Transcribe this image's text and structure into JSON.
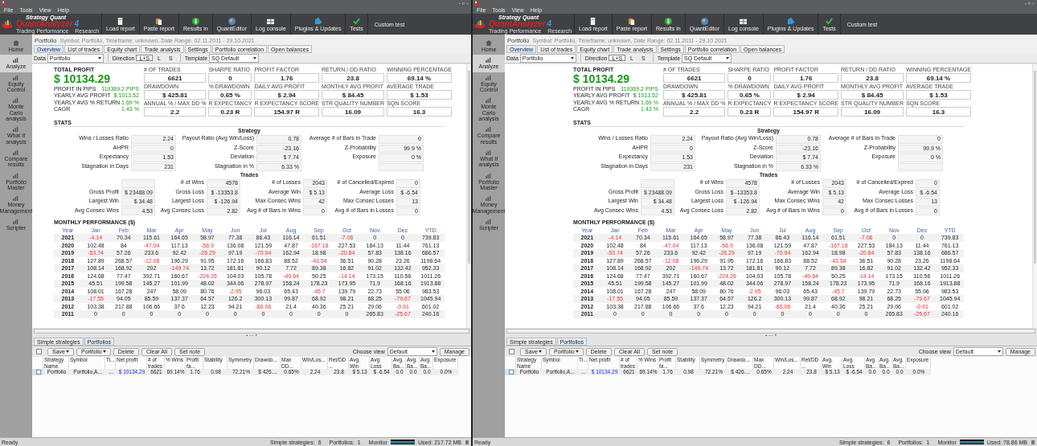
{
  "windows": [
    {
      "menu": [
        "File",
        "Tools",
        "View",
        "Help"
      ],
      "logo": {
        "brand": "Strategy Quant",
        "name": "QuantAnalyzer",
        "version": "4",
        "tagline": "Trading Performance    Research"
      },
      "toolbar": [
        {
          "label": "Load report",
          "kind": "icon"
        },
        {
          "label": "Paste report",
          "kind": "icon"
        },
        {
          "label": "Results in",
          "kind": "icon"
        },
        {
          "label": "QuantEditor",
          "kind": "icon"
        },
        {
          "label": "Log console",
          "kind": "icon"
        },
        {
          "label": "Plugins & Updates",
          "kind": "icon"
        },
        {
          "label": "Tests",
          "kind": "icon"
        },
        {
          "label": "Custom test",
          "kind": "text"
        }
      ],
      "sidebar": [
        {
          "label": "Home",
          "selected": false
        },
        {
          "label": "Analyze",
          "selected": true
        },
        {
          "label": "Equity Control",
          "selected": false
        },
        {
          "label": "Monte Carlo analysis",
          "selected": false
        },
        {
          "label": "What If analysis",
          "selected": false
        },
        {
          "label": "Compare results",
          "selected": false
        },
        {
          "label": "Portfolio Master",
          "selected": false
        },
        {
          "label": "Money Management",
          "selected": false
        },
        {
          "label": "Scripter",
          "selected": false
        }
      ],
      "header": {
        "title": "Portfolio",
        "info": "Symbol: Portfolio, Timeframe: unknown, Date Range: 02.11.2011 - 29.10.2021"
      },
      "tabs": [
        {
          "label": "Overview",
          "selected": true
        },
        {
          "label": "List of trades",
          "selected": false
        },
        {
          "label": "Equity chart",
          "selected": false
        },
        {
          "label": "Trade analysis",
          "selected": false
        },
        {
          "label": "Settings",
          "selected": false
        },
        {
          "label": "Portfolio correlation",
          "selected": false
        },
        {
          "label": "Open balances",
          "selected": false
        }
      ],
      "filters": {
        "data_label": "Data",
        "data_value": "Portfolio",
        "direction_label": "Direction",
        "directions": [
          {
            "label": "L+S",
            "selected": true
          },
          {
            "label": "L",
            "selected": false
          },
          {
            "label": "S",
            "selected": false
          }
        ],
        "template_label": "Template",
        "template_value": "SQ Default"
      },
      "summary": {
        "total_label": "TOTAL PROFIT",
        "total": "$ 10134.29",
        "rows": [
          {
            "label": "PROFIT IN PIPS",
            "value": "119369.2 PIPS"
          },
          {
            "label": "YEARLY AVG PROFIT",
            "value": "$ 1013.52"
          },
          {
            "label": "YEARLY AVG % RETURN",
            "value": "1.69 %"
          },
          {
            "label": "CAGR",
            "value": "1.43 %"
          }
        ],
        "metrics": [
          {
            "label": "# OF TRADES",
            "value": "6621"
          },
          {
            "label": "SHARPE RATIO",
            "value": "0"
          },
          {
            "label": "PROFIT FACTOR",
            "value": "1.76"
          },
          {
            "label": "RETURN / DD RATIO",
            "value": "23.8"
          },
          {
            "label": "WINNING PERCENTAGE",
            "value": "69.14 %"
          },
          {
            "label": "DRAWDOWN",
            "value": "$ 425.81"
          },
          {
            "label": "% DRAWDOWN",
            "value": "0.65 %"
          },
          {
            "label": "DAILY AVG PROFIT",
            "value": "$ 2.94"
          },
          {
            "label": "MONTHLY AVG PROFIT",
            "value": "$ 84.45"
          },
          {
            "label": "AVERAGE TRADE",
            "value": "$ 1.53"
          },
          {
            "label": "ANNUAL % / MAX DD %",
            "value": "2.2"
          },
          {
            "label": "R EXPECTANCY",
            "value": "0.23 R"
          },
          {
            "label": "R EXPECTANCY SCORE",
            "value": "154.97 R"
          },
          {
            "label": "STR QUALITY NUMBER",
            "value": "16.09"
          },
          {
            "label": "SQN SCORE",
            "value": "16.3"
          }
        ]
      },
      "stats": {
        "title": "STATS",
        "strategy_title": "Strategy",
        "strategy": [
          {
            "label": "Wins / Losses Ratio",
            "value": "2.24",
            "kind": "pair"
          },
          {
            "label": "Payout Ratio (Avg Win/Loss)",
            "value": "0.78",
            "kind": "pair"
          },
          {
            "label": "Average # of Bars in Trade",
            "value": "0",
            "kind": "pair"
          },
          {
            "label": "AHPR",
            "value": "0",
            "kind": "pair"
          },
          {
            "label": "Z-Score",
            "value": "-23.16",
            "kind": "pair"
          },
          {
            "label": "Z-Probability",
            "value": "99.9 %",
            "kind": "pair"
          },
          {
            "label": "Expectancy",
            "value": "1.53",
            "kind": "pair"
          },
          {
            "label": "Deviation",
            "value": "$ 7.74",
            "kind": "pair"
          },
          {
            "label": "Exposure",
            "value": "0 %",
            "kind": "pair"
          },
          {
            "label": "Stagnation in Days",
            "value": "231",
            "kind": "pair"
          },
          {
            "label": "Stagnation in %",
            "value": "6.33 %",
            "kind": "pair"
          },
          {
            "kind": "blank"
          }
        ],
        "trades_title": "Trades",
        "trades": [
          {
            "kind": "blank"
          },
          {
            "label": "# of Wins",
            "value": "4578",
            "kind": "pair"
          },
          {
            "label": "# of Losses",
            "value": "2043",
            "kind": "pair"
          },
          {
            "label": "# of Cancelled/Expired",
            "value": "0",
            "kind": "pair"
          },
          {
            "label": "Gross Profit",
            "value": "$ 23488.09",
            "kind": "pair"
          },
          {
            "label": "Gross Loss",
            "value": "$ -13353.8",
            "kind": "pair"
          },
          {
            "label": "Average Win",
            "value": "$ 5.13",
            "kind": "pair"
          },
          {
            "label": "Average Loss",
            "value": "$ -6.54",
            "kind": "pair"
          },
          {
            "label": "Largest Win",
            "value": "$ 34.48",
            "kind": "pair"
          },
          {
            "label": "Largest Loss",
            "value": "$ -126.94",
            "kind": "pair"
          },
          {
            "label": "Max Consec Wins",
            "value": "42",
            "kind": "pair"
          },
          {
            "label": "Max Consec Losses",
            "value": "13",
            "kind": "pair"
          },
          {
            "label": "Avg Consec Wins",
            "value": "4.53",
            "kind": "pair"
          },
          {
            "label": "Avg Consec Loss",
            "value": "2.82",
            "kind": "pair"
          },
          {
            "label": "Avg # of Bars in Wins",
            "value": "0",
            "kind": "pair"
          },
          {
            "label": "Avg # of Bars in Losses",
            "value": "0",
            "kind": "pair"
          }
        ]
      },
      "monthly": {
        "title": "MONTHLY PERFORMANCE ($)",
        "columns": [
          "Year",
          "Jan",
          "Feb",
          "Mar",
          "Apr",
          "May",
          "Jun",
          "Jul",
          "Aug",
          "Sep",
          "Oct",
          "Nov",
          "Dec",
          "YTD"
        ],
        "rows": [
          {
            "year": "2021",
            "values": [
              "-4.14",
              "70.34",
              "115.61",
              "164.65",
              "58.97",
              "77.38",
              "86.43",
              "116.14",
              "61.51",
              "-7.06",
              "0",
              "0",
              "739.83"
            ],
            "negative": [
              true,
              false,
              false,
              false,
              false,
              false,
              false,
              false,
              false,
              true,
              false,
              false,
              false
            ]
          },
          {
            "year": "2020",
            "values": [
              "102.48",
              "84",
              "-47.04",
              "117.13",
              "-56.9",
              "136.08",
              "121.59",
              "47.87",
              "-167.18",
              "227.53",
              "184.13",
              "11.44",
              "761.13"
            ],
            "negative": [
              false,
              false,
              true,
              false,
              true,
              false,
              false,
              false,
              true,
              false,
              false,
              false,
              false
            ]
          },
          {
            "year": "2019",
            "values": [
              "-53.74",
              "57.26",
              "233.6",
              "92.42",
              "-26.29",
              "97.19",
              "-70.94",
              "162.94",
              "18.98",
              "-20.84",
              "57.83",
              "138.16",
              "686.57"
            ],
            "negative": [
              true,
              false,
              false,
              false,
              true,
              false,
              true,
              false,
              false,
              true,
              false,
              false,
              false
            ]
          },
          {
            "year": "2018",
            "values": [
              "127.89",
              "268.57",
              "-12.08",
              "196.29",
              "91.95",
              "172.16",
              "166.83",
              "88.52",
              "-43.54",
              "36.51",
              "90.28",
              "23.26",
              "1198.64"
            ],
            "negative": [
              false,
              false,
              true,
              false,
              false,
              false,
              false,
              false,
              true,
              false,
              false,
              false,
              false
            ]
          },
          {
            "year": "2017",
            "values": [
              "108.14",
              "168.92",
              "202",
              "-149.74",
              "13.72",
              "181.81",
              "90.12",
              "7.72",
              "89.38",
              "16.82",
              "91.02",
              "132.42",
              "952.33"
            ],
            "negative": [
              false,
              false,
              false,
              true,
              false,
              false,
              false,
              false,
              false,
              false,
              false,
              false,
              false
            ]
          },
          {
            "year": "2016",
            "values": [
              "124.68",
              "77.47",
              "392.71",
              "160.67",
              "-224.26",
              "104.03",
              "105.78",
              "-49.64",
              "50.25",
              "-14.14",
              "173.15",
              "110.56",
              "1011.26"
            ],
            "negative": [
              false,
              false,
              false,
              false,
              true,
              false,
              false,
              true,
              false,
              true,
              false,
              false,
              false
            ]
          },
          {
            "year": "2015",
            "values": [
              "45.51",
              "199.58",
              "145.27",
              "101.99",
              "48.02",
              "344.06",
              "278.97",
              "158.24",
              "178.23",
              "173.95",
              "71.9",
              "168.16",
              "1913.88"
            ],
            "negative": [
              false,
              false,
              false,
              false,
              false,
              false,
              false,
              false,
              false,
              false,
              false,
              false,
              false
            ]
          },
          {
            "year": "2014",
            "values": [
              "108.01",
              "167.28",
              "247",
              "58.09",
              "80.76",
              "-2.95",
              "96.03",
              "65.43",
              "-45.7",
              "139.79",
              "22.73",
              "55.06",
              "983.53"
            ],
            "negative": [
              false,
              false,
              false,
              false,
              false,
              true,
              false,
              false,
              true,
              false,
              false,
              false,
              false
            ]
          },
          {
            "year": "2013",
            "values": [
              "-17.55",
              "94.05",
              "85.59",
              "137.37",
              "64.57",
              "126.2",
              "300.13",
              "99.87",
              "68.92",
              "98.21",
              "68.25",
              "-79.67",
              "1045.94"
            ],
            "negative": [
              true,
              false,
              false,
              false,
              false,
              false,
              false,
              false,
              false,
              false,
              false,
              true,
              false
            ]
          },
          {
            "year": "2012",
            "values": [
              "103.38",
              "217.88",
              "106.66",
              "37.6",
              "12.23",
              "94.21",
              "-86.06",
              "21.4",
              "40.36",
              "25.21",
              "29.06",
              "-0.91",
              "601.02"
            ],
            "negative": [
              false,
              false,
              false,
              false,
              false,
              false,
              true,
              false,
              false,
              false,
              false,
              true,
              false
            ]
          },
          {
            "year": "2011",
            "values": [
              "0",
              "0",
              "0",
              "0",
              "0",
              "0",
              "0",
              "0",
              "0",
              "0",
              "265.83",
              "-25.67",
              "240.16"
            ],
            "negative": [
              false,
              false,
              false,
              false,
              false,
              false,
              false,
              false,
              false,
              false,
              false,
              true,
              false
            ]
          }
        ]
      },
      "bottom_tabs": [
        {
          "label": "Simple strategies",
          "selected": false
        },
        {
          "label": "Portfolios",
          "selected": true
        }
      ],
      "actions": [
        {
          "label": "Save",
          "dropdown": true
        },
        {
          "label": "Portfolio",
          "dropdown": true
        },
        {
          "label": "Delete",
          "dropdown": false
        },
        {
          "label": "Clear All",
          "dropdown": false
        },
        {
          "label": "Set note",
          "dropdown": false
        }
      ],
      "view": {
        "label": "Choose view",
        "value": "Default",
        "button": "Manage"
      },
      "table": {
        "select_all_checked": false,
        "columns": [
          "Strategy Name",
          "Symbol",
          "Ti...",
          "Net profit",
          "# of trades",
          "% Wins",
          "Profit fa...",
          "Stability",
          "Symmetry",
          "Drawdo...",
          "Max DD...",
          "Win/Los...",
          "Ret/DD ...",
          "Avg. Win",
          "Avg. Loss",
          "Avg. Ba...",
          "Avg. Ba...",
          "Avg. Ba...",
          "Exposure"
        ],
        "rows": [
          {
            "checked": false,
            "cells": [
              "Portfolio",
              "Portfolio,A...",
              "...",
              "$ 10134.29",
              "6621",
              "69.14%",
              "1.76",
              "0.98",
              "72.21%",
              "$ 426....",
              "0.65%",
              "2.24",
              "23.8",
              "$ 5.13",
              "$ -6.54",
              "0.0",
              "0.0",
              "0.0",
              "0.0%"
            ]
          }
        ]
      },
      "status": {
        "left": "Ready",
        "strategies_label": "Simple strategies:",
        "strategies": "6",
        "portfolios_label": "Portfolios:",
        "portfolios": "1",
        "monitor_label": "Monitor",
        "used": "Used: 217.72 MB"
      }
    },
    {
      "menu": [
        "File",
        "Tools",
        "View",
        "Help"
      ],
      "logo": {
        "brand": "Strategy Quant",
        "name": "QuantAnalyzer",
        "version": "4",
        "tagline": "Trading Performance    Research"
      },
      "toolbar": [
        {
          "label": "Load report",
          "kind": "icon"
        },
        {
          "label": "Paste report",
          "kind": "icon"
        },
        {
          "label": "Results in",
          "kind": "icon"
        },
        {
          "label": "QuantEditor",
          "kind": "icon"
        },
        {
          "label": "Log console",
          "kind": "icon"
        },
        {
          "label": "Plugins & Updates",
          "kind": "icon"
        },
        {
          "label": "Tests",
          "kind": "icon"
        },
        {
          "label": "Custom test",
          "kind": "text"
        }
      ],
      "sidebar": [
        {
          "label": "Home",
          "selected": false
        },
        {
          "label": "Analyze",
          "selected": true
        },
        {
          "label": "Equity Control",
          "selected": false
        },
        {
          "label": "Monte Carlo analysis",
          "selected": false
        },
        {
          "label": "Compare results",
          "selected": false
        },
        {
          "label": "What If analysis",
          "selected": false
        },
        {
          "label": "Portfolio Master",
          "selected": false
        },
        {
          "label": "Money Management",
          "selected": false
        },
        {
          "label": "Scripter",
          "selected": false
        }
      ],
      "header": {
        "title": "Portfolio",
        "info": "Symbol: Portfolio, Timeframe: unknown, Date Range: 02.11.2011 - 29.10.2021"
      },
      "tabs": [
        {
          "label": "Overview",
          "selected": true
        },
        {
          "label": "List of trades",
          "selected": false
        },
        {
          "label": "Equity chart",
          "selected": false
        },
        {
          "label": "Trade analysis",
          "selected": false
        },
        {
          "label": "Settings",
          "selected": false
        },
        {
          "label": "Portfolio correlation",
          "selected": false
        },
        {
          "label": "Open balances",
          "selected": false
        }
      ],
      "filters": {
        "data_label": "Data",
        "data_value": "Portfolio",
        "direction_label": "Direction",
        "directions": [
          {
            "label": "L+S",
            "selected": true
          },
          {
            "label": "L",
            "selected": false
          },
          {
            "label": "S",
            "selected": false
          }
        ],
        "template_label": "Template",
        "template_value": "SQ Default"
      },
      "summary": {
        "total_label": "TOTAL PROFIT",
        "total": "$ 10134.29",
        "rows": [
          {
            "label": "PROFIT IN PIPS",
            "value": "119369.2 PIPS"
          },
          {
            "label": "YEARLY AVG PROFIT",
            "value": "$ 1013.52"
          },
          {
            "label": "YEARLY AVG % RETURN",
            "value": "1.69 %"
          },
          {
            "label": "CAGR",
            "value": "1.43 %"
          }
        ],
        "metrics": [
          {
            "label": "# OF TRADES",
            "value": "6621"
          },
          {
            "label": "SHARPE RATIO",
            "value": "0"
          },
          {
            "label": "PROFIT FACTOR",
            "value": "1.76"
          },
          {
            "label": "RETURN / DD RATIO",
            "value": "23.8"
          },
          {
            "label": "WINNING PERCENTAGE",
            "value": "69.14 %"
          },
          {
            "label": "DRAWDOWN",
            "value": "$ 425.81"
          },
          {
            "label": "% DRAWDOWN",
            "value": "0.65 %"
          },
          {
            "label": "DAILY AVG PROFIT",
            "value": "$ 2.94"
          },
          {
            "label": "MONTHLY AVG PROFIT",
            "value": "$ 84.45"
          },
          {
            "label": "AVERAGE TRADE",
            "value": "$ 1.53"
          },
          {
            "label": "ANNUAL % / MAX DD %",
            "value": "2.2"
          },
          {
            "label": "R EXPECTANCY",
            "value": "0.23 R"
          },
          {
            "label": "R EXPECTANCY SCORE",
            "value": "154.97 R"
          },
          {
            "label": "STR QUALITY NUMBER",
            "value": "16.09"
          },
          {
            "label": "SQN SCORE",
            "value": "16.3"
          }
        ]
      },
      "stats": {
        "title": "STATS",
        "strategy_title": "Strategy",
        "strategy": [
          {
            "label": "Wins / Losses Ratio",
            "value": "2.24",
            "kind": "pair"
          },
          {
            "label": "Payout Ratio (Avg Win/Loss)",
            "value": "0.78",
            "kind": "pair"
          },
          {
            "label": "Average # of Bars in Trade",
            "value": "0",
            "kind": "pair"
          },
          {
            "label": "AHPR",
            "value": "0",
            "kind": "pair"
          },
          {
            "label": "Z-Score",
            "value": "-23.16",
            "kind": "pair"
          },
          {
            "label": "Z-Probability",
            "value": "99.9 %",
            "kind": "pair"
          },
          {
            "label": "Expectancy",
            "value": "1.53",
            "kind": "pair"
          },
          {
            "label": "Deviation",
            "value": "$ 7.74",
            "kind": "pair"
          },
          {
            "label": "Exposure",
            "value": "0 %",
            "kind": "pair"
          },
          {
            "label": "Stagnation in Days",
            "value": "231",
            "kind": "pair"
          },
          {
            "label": "Stagnation in %",
            "value": "6.33 %",
            "kind": "pair"
          },
          {
            "kind": "blank"
          }
        ],
        "trades_title": "Trades",
        "trades": [
          {
            "kind": "blank"
          },
          {
            "label": "# of Wins",
            "value": "4578",
            "kind": "pair"
          },
          {
            "label": "# of Losses",
            "value": "2043",
            "kind": "pair"
          },
          {
            "label": "# of Cancelled/Expired",
            "value": "0",
            "kind": "pair"
          },
          {
            "label": "Gross Profit",
            "value": "$ 23488.09",
            "kind": "pair"
          },
          {
            "label": "Gross Loss",
            "value": "$ -13353.8",
            "kind": "pair"
          },
          {
            "label": "Average Win",
            "value": "$ 5.13",
            "kind": "pair"
          },
          {
            "label": "Average Loss",
            "value": "$ -6.54",
            "kind": "pair"
          },
          {
            "label": "Largest Win",
            "value": "$ 34.48",
            "kind": "pair"
          },
          {
            "label": "Largest Loss",
            "value": "$ -126.94",
            "kind": "pair"
          },
          {
            "label": "Max Consec Wins",
            "value": "42",
            "kind": "pair"
          },
          {
            "label": "Max Consec Losses",
            "value": "13",
            "kind": "pair"
          },
          {
            "label": "Avg Consec Wins",
            "value": "4.53",
            "kind": "pair"
          },
          {
            "label": "Avg Consec Loss",
            "value": "2.82",
            "kind": "pair"
          },
          {
            "label": "Avg # of Bars in Wins",
            "value": "0",
            "kind": "pair"
          },
          {
            "label": "Avg # of Bars in Losses",
            "value": "0",
            "kind": "pair"
          }
        ]
      },
      "monthly": {
        "title": "MONTHLY PERFORMANCE ($)",
        "columns": [
          "Year",
          "Jan",
          "Feb",
          "Mar",
          "Apr",
          "May",
          "Jun",
          "Jul",
          "Aug",
          "Sep",
          "Oct",
          "Nov",
          "Dec",
          "YTD"
        ],
        "rows": [
          {
            "year": "2021",
            "values": [
              "-4.14",
              "70.34",
              "115.61",
              "164.65",
              "58.97",
              "77.38",
              "86.43",
              "116.14",
              "61.51",
              "-7.06",
              "0",
              "0",
              "739.83"
            ],
            "negative": [
              true,
              false,
              false,
              false,
              false,
              false,
              false,
              false,
              false,
              true,
              false,
              false,
              false
            ]
          },
          {
            "year": "2020",
            "values": [
              "102.48",
              "84",
              "-47.04",
              "117.13",
              "-56.9",
              "136.08",
              "121.59",
              "47.87",
              "-167.18",
              "227.53",
              "184.13",
              "11.44",
              "761.13"
            ],
            "negative": [
              false,
              false,
              true,
              false,
              true,
              false,
              false,
              false,
              true,
              false,
              false,
              false,
              false
            ]
          },
          {
            "year": "2019",
            "values": [
              "-53.74",
              "57.26",
              "233.6",
              "92.42",
              "-26.29",
              "97.19",
              "-70.94",
              "162.94",
              "18.98",
              "-20.84",
              "57.83",
              "138.16",
              "686.57"
            ],
            "negative": [
              true,
              false,
              false,
              false,
              true,
              false,
              true,
              false,
              false,
              true,
              false,
              false,
              false
            ]
          },
          {
            "year": "2018",
            "values": [
              "127.89",
              "268.57",
              "-12.08",
              "196.29",
              "91.95",
              "172.16",
              "166.83",
              "88.52",
              "-43.54",
              "36.51",
              "90.28",
              "23.26",
              "1198.64"
            ],
            "negative": [
              false,
              false,
              true,
              false,
              false,
              false,
              false,
              false,
              true,
              false,
              false,
              false,
              false
            ]
          },
          {
            "year": "2017",
            "values": [
              "108.14",
              "168.92",
              "202",
              "-149.74",
              "13.72",
              "181.81",
              "90.12",
              "7.72",
              "89.38",
              "16.82",
              "91.02",
              "132.42",
              "952.33"
            ],
            "negative": [
              false,
              false,
              false,
              true,
              false,
              false,
              false,
              false,
              false,
              false,
              false,
              false,
              false
            ]
          },
          {
            "year": "2016",
            "values": [
              "124.68",
              "77.47",
              "392.71",
              "160.67",
              "-224.26",
              "104.03",
              "105.78",
              "-49.64",
              "50.25",
              "-14.14",
              "173.15",
              "110.56",
              "1011.26"
            ],
            "negative": [
              false,
              false,
              false,
              false,
              true,
              false,
              false,
              true,
              false,
              true,
              false,
              false,
              false
            ]
          },
          {
            "year": "2015",
            "values": [
              "45.51",
              "199.58",
              "145.27",
              "101.99",
              "48.02",
              "344.06",
              "278.97",
              "158.24",
              "178.23",
              "173.95",
              "71.9",
              "168.16",
              "1913.88"
            ],
            "negative": [
              false,
              false,
              false,
              false,
              false,
              false,
              false,
              false,
              false,
              false,
              false,
              false,
              false
            ]
          },
          {
            "year": "2014",
            "values": [
              "108.01",
              "167.28",
              "247",
              "58.09",
              "80.76",
              "-2.95",
              "96.03",
              "65.43",
              "-45.7",
              "139.79",
              "22.73",
              "55.06",
              "983.53"
            ],
            "negative": [
              false,
              false,
              false,
              false,
              false,
              true,
              false,
              false,
              true,
              false,
              false,
              false,
              false
            ]
          },
          {
            "year": "2013",
            "values": [
              "-17.55",
              "94.05",
              "85.59",
              "137.37",
              "64.57",
              "126.2",
              "300.13",
              "99.87",
              "68.92",
              "98.21",
              "68.25",
              "-79.67",
              "1045.94"
            ],
            "negative": [
              true,
              false,
              false,
              false,
              false,
              false,
              false,
              false,
              false,
              false,
              false,
              true,
              false
            ]
          },
          {
            "year": "2012",
            "values": [
              "103.38",
              "217.88",
              "106.66",
              "37.6",
              "12.23",
              "94.21",
              "-86.06",
              "21.4",
              "40.36",
              "25.21",
              "29.06",
              "-0.91",
              "601.02"
            ],
            "negative": [
              false,
              false,
              false,
              false,
              false,
              false,
              true,
              false,
              false,
              false,
              false,
              true,
              false
            ]
          },
          {
            "year": "2011",
            "values": [
              "0",
              "0",
              "0",
              "0",
              "0",
              "0",
              "0",
              "0",
              "0",
              "0",
              "265.83",
              "-25.67",
              "240.16"
            ],
            "negative": [
              false,
              false,
              false,
              false,
              false,
              false,
              false,
              false,
              false,
              false,
              false,
              true,
              false
            ]
          }
        ]
      },
      "bottom_tabs": [
        {
          "label": "Simple strategies",
          "selected": false
        },
        {
          "label": "Portfolios",
          "selected": true
        }
      ],
      "actions": [
        {
          "label": "Save",
          "dropdown": true
        },
        {
          "label": "Portfolio",
          "dropdown": true
        },
        {
          "label": "Delete",
          "dropdown": false
        },
        {
          "label": "Clear All",
          "dropdown": false
        },
        {
          "label": "Set note",
          "dropdown": false
        }
      ],
      "view": {
        "label": "Choose view",
        "value": "Default",
        "button": "Manage"
      },
      "table": {
        "select_all_checked": false,
        "columns": [
          "Strategy Name",
          "Symbol",
          "Ti...",
          "Net profit",
          "# of trades",
          "% Wins",
          "Profit fa...",
          "Stability",
          "Symmetry",
          "Drawdo...",
          "Max DD...",
          "Win/Los...",
          "Ret/DD ...",
          "Avg. Win",
          "Avg. Loss",
          "Avg. Ba...",
          "Avg. Ba...",
          "Avg. Ba...",
          "Exposure"
        ],
        "rows": [
          {
            "checked": false,
            "cells": [
              "Portfolio",
              "Portfolio,A...",
              "...",
              "$ 10134.29",
              "6621",
              "69.14%",
              "1.76",
              "0.98",
              "72.21%",
              "$ 426....",
              "0.65%",
              "2.24",
              "23.8",
              "$ 5.13",
              "$ -6.54",
              "0.0",
              "0.0",
              "0.0",
              "0.0%"
            ]
          }
        ]
      },
      "status": {
        "left": "Ready",
        "strategies_label": "Simple strategies:",
        "strategies": "6",
        "portfolios_label": "Portfolios:",
        "portfolios": "1",
        "monitor_label": "Monitor",
        "used": "Used: 78.86 MB"
      }
    }
  ]
}
